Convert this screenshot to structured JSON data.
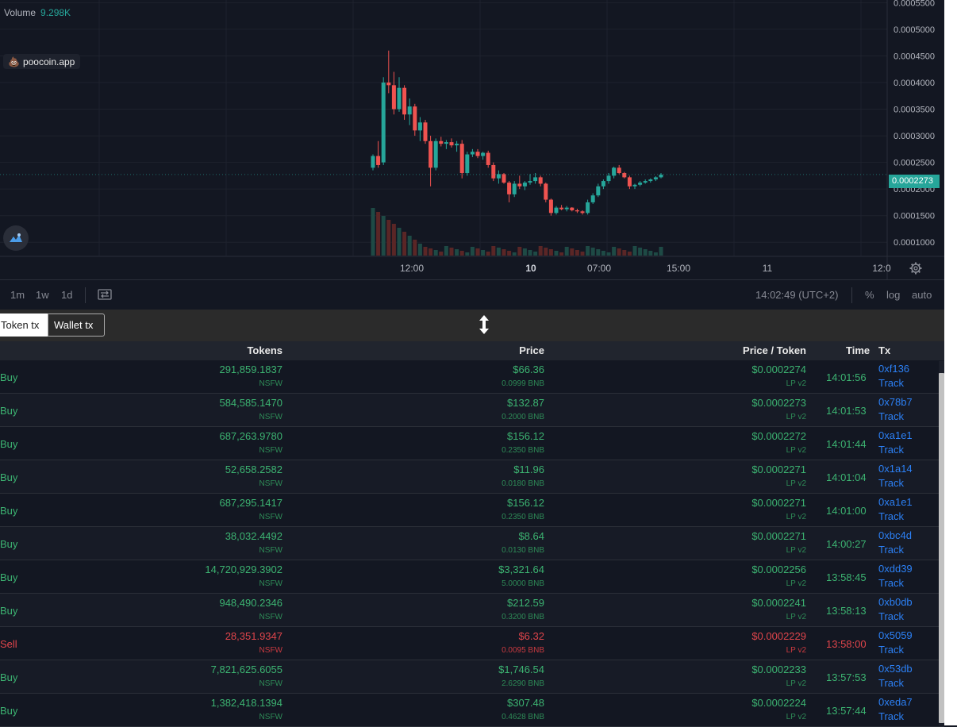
{
  "chart": {
    "volume_label": "Volume",
    "volume_value": "9.298K",
    "brand": "poocoin.app",
    "current_price_tag": "0.0002273",
    "price_axis": [
      "0.0005500",
      "0.0005000",
      "0.0004500",
      "0.0004000",
      "0.0003500",
      "0.0003000",
      "0.0002500",
      "0.0002000",
      "0.0001500",
      "0.0001000"
    ],
    "time_axis": [
      {
        "label": "12:00",
        "bold": false
      },
      {
        "label": "10",
        "bold": true
      },
      {
        "label": "07:00",
        "bold": false
      },
      {
        "label": "15:00",
        "bold": false
      },
      {
        "label": "11",
        "bold": false
      },
      {
        "label": "12:0",
        "bold": false
      }
    ],
    "colors": {
      "up": "#26a69a",
      "down": "#ef5350",
      "bg": "#131722",
      "grid": "#1e222d"
    }
  },
  "chart_data": {
    "type": "candlestick",
    "ylim": [
      7.5e-05,
      0.000555
    ],
    "candles": [
      [
        0.00024,
        0.000265,
        0.000235,
        0.000262
      ],
      [
        0.000262,
        0.00029,
        0.00024,
        0.000245
      ],
      [
        0.00025,
        0.00041,
        0.000245,
        0.0004
      ],
      [
        0.0004,
        0.00046,
        0.00038,
        0.000395
      ],
      [
        0.000395,
        0.00042,
        0.00034,
        0.00035
      ],
      [
        0.00035,
        0.00041,
        0.000345,
        0.00039
      ],
      [
        0.00039,
        0.000395,
        0.00033,
        0.00034
      ],
      [
        0.00034,
        0.00037,
        0.00032,
        0.000355
      ],
      [
        0.000355,
        0.00036,
        0.0003,
        0.00031
      ],
      [
        0.00031,
        0.000335,
        0.00029,
        0.000325
      ],
      [
        0.000325,
        0.00033,
        0.000285,
        0.00029
      ],
      [
        0.00029,
        0.0003,
        0.000205,
        0.00024
      ],
      [
        0.00024,
        0.000295,
        0.000235,
        0.00029
      ],
      [
        0.00029,
        0.000298,
        0.00028,
        0.000285
      ],
      [
        0.000285,
        0.000292,
        0.000275,
        0.000288
      ],
      [
        0.000288,
        0.000295,
        0.000278,
        0.000282
      ],
      [
        0.000282,
        0.00029,
        0.00027,
        0.000285
      ],
      [
        0.000285,
        0.000292,
        0.00022,
        0.00023
      ],
      [
        0.00023,
        0.00027,
        0.000225,
        0.000265
      ],
      [
        0.000265,
        0.000275,
        0.00026,
        0.00027
      ],
      [
        0.00027,
        0.000275,
        0.000258,
        0.000262
      ],
      [
        0.000262,
        0.00027,
        0.000255,
        0.000268
      ],
      [
        0.000268,
        0.000272,
        0.00024,
        0.000245
      ],
      [
        0.000245,
        0.00025,
        0.000215,
        0.00022
      ],
      [
        0.00022,
        0.000235,
        0.00021,
        0.000228
      ],
      [
        0.000228,
        0.00023,
        0.00021,
        0.000212
      ],
      [
        0.000212,
        0.000215,
        0.000175,
        0.00019
      ],
      [
        0.00019,
        0.000215,
        0.000185,
        0.00021
      ],
      [
        0.00021,
        0.000225,
        0.0002,
        0.000205
      ],
      [
        0.000205,
        0.000215,
        0.000198,
        0.000212
      ],
      [
        0.000212,
        0.000228,
        0.000208,
        0.000215
      ],
      [
        0.000215,
        0.00023,
        0.00021,
        0.000222
      ],
      [
        0.000222,
        0.000225,
        0.000205,
        0.00021
      ],
      [
        0.00021,
        0.000212,
        0.000175,
        0.00018
      ],
      [
        0.00018,
        0.000182,
        0.00015,
        0.000155
      ],
      [
        0.000155,
        0.000168,
        0.000152,
        0.000165
      ],
      [
        0.000165,
        0.00017,
        0.00016,
        0.000162
      ],
      [
        0.000162,
        0.000168,
        0.000158,
        0.000165
      ],
      [
        0.000165,
        0.000166,
        0.000158,
        0.00016
      ],
      [
        0.00016,
        0.000163,
        0.000155,
        0.000158
      ],
      [
        0.000158,
        0.00016,
        0.000152,
        0.000155
      ],
      [
        0.000155,
        0.00018,
        0.000152,
        0.000175
      ],
      [
        0.000175,
        0.000192,
        0.000172,
        0.000188
      ],
      [
        0.000188,
        0.00021,
        0.000185,
        0.000205
      ],
      [
        0.000205,
        0.000218,
        0.0002,
        0.000215
      ],
      [
        0.000215,
        0.00023,
        0.00021,
        0.000225
      ],
      [
        0.000225,
        0.000242,
        0.00022,
        0.00024
      ],
      [
        0.00024,
        0.000245,
        0.000228,
        0.00023
      ],
      [
        0.00023,
        0.000232,
        0.00022,
        0.000222
      ],
      [
        0.000222,
        0.000225,
        0.0002,
        0.000205
      ],
      [
        0.000205,
        0.00021,
        0.0002,
        0.000208
      ],
      [
        0.000208,
        0.000215,
        0.000205,
        0.000212
      ],
      [
        0.000212,
        0.000218,
        0.00021,
        0.000215
      ],
      [
        0.000215,
        0.00022,
        0.000212,
        0.000218
      ],
      [
        0.000218,
        0.000224,
        0.000215,
        0.000222
      ],
      [
        0.000222,
        0.00023,
        0.00022,
        0.000227
      ]
    ]
  },
  "toolbar": {
    "intervals": [
      "1m",
      "1w",
      "1d"
    ],
    "clock": "14:02:49 (UTC+2)",
    "options": [
      "%",
      "log",
      "auto"
    ]
  },
  "tabs": {
    "token_tx": "Token tx",
    "wallet_tx": "Wallet tx"
  },
  "table": {
    "headers": {
      "tokens": "Tokens",
      "price": "Price",
      "price_token": "Price / Token",
      "time": "Time",
      "tx": "Tx"
    },
    "rows": [
      {
        "type": "Buy",
        "tokens": "291,859.1837",
        "symbol": "NSFW",
        "usd": "$66.36",
        "bnb": "0.0999 BNB",
        "ppt": "$0.0002274",
        "lp": "LP v2",
        "time": "14:01:56",
        "tx": "0xf136",
        "track": "Track"
      },
      {
        "type": "Buy",
        "tokens": "584,585.1470",
        "symbol": "NSFW",
        "usd": "$132.87",
        "bnb": "0.2000 BNB",
        "ppt": "$0.0002273",
        "lp": "LP v2",
        "time": "14:01:53",
        "tx": "0x78b7",
        "track": "Track"
      },
      {
        "type": "Buy",
        "tokens": "687,263.9780",
        "symbol": "NSFW",
        "usd": "$156.12",
        "bnb": "0.2350 BNB",
        "ppt": "$0.0002272",
        "lp": "LP v2",
        "time": "14:01:44",
        "tx": "0xa1e1",
        "track": "Track"
      },
      {
        "type": "Buy",
        "tokens": "52,658.2582",
        "symbol": "NSFW",
        "usd": "$11.96",
        "bnb": "0.0180 BNB",
        "ppt": "$0.0002271",
        "lp": "LP v2",
        "time": "14:01:04",
        "tx": "0x1a14",
        "track": "Track"
      },
      {
        "type": "Buy",
        "tokens": "687,295.1417",
        "symbol": "NSFW",
        "usd": "$156.12",
        "bnb": "0.2350 BNB",
        "ppt": "$0.0002271",
        "lp": "LP v2",
        "time": "14:01:00",
        "tx": "0xa1e1",
        "track": "Track"
      },
      {
        "type": "Buy",
        "tokens": "38,032.4492",
        "symbol": "NSFW",
        "usd": "$8.64",
        "bnb": "0.0130 BNB",
        "ppt": "$0.0002271",
        "lp": "LP v2",
        "time": "14:00:27",
        "tx": "0xbc4d",
        "track": "Track"
      },
      {
        "type": "Buy",
        "tokens": "14,720,929.3902",
        "symbol": "NSFW",
        "usd": "$3,321.64",
        "bnb": "5.0000 BNB",
        "ppt": "$0.0002256",
        "lp": "LP v2",
        "time": "13:58:45",
        "tx": "0xdd39",
        "track": "Track"
      },
      {
        "type": "Buy",
        "tokens": "948,490.2346",
        "symbol": "NSFW",
        "usd": "$212.59",
        "bnb": "0.3200 BNB",
        "ppt": "$0.0002241",
        "lp": "LP v2",
        "time": "13:58:13",
        "tx": "0xb0db",
        "track": "Track"
      },
      {
        "type": "Sell",
        "tokens": "28,351.9347",
        "symbol": "NSFW",
        "usd": "$6.32",
        "bnb": "0.0095 BNB",
        "ppt": "$0.0002229",
        "lp": "LP v2",
        "time": "13:58:00",
        "tx": "0x5059",
        "track": "Track"
      },
      {
        "type": "Buy",
        "tokens": "7,821,625.6055",
        "symbol": "NSFW",
        "usd": "$1,746.54",
        "bnb": "2.6290 BNB",
        "ppt": "$0.0002233",
        "lp": "LP v2",
        "time": "13:57:53",
        "tx": "0x53db",
        "track": "Track"
      },
      {
        "type": "Buy",
        "tokens": "1,382,418.1394",
        "symbol": "NSFW",
        "usd": "$307.48",
        "bnb": "0.4628 BNB",
        "ppt": "$0.0002224",
        "lp": "LP v2",
        "time": "13:57:44",
        "tx": "0xeda7",
        "track": "Track"
      }
    ]
  }
}
